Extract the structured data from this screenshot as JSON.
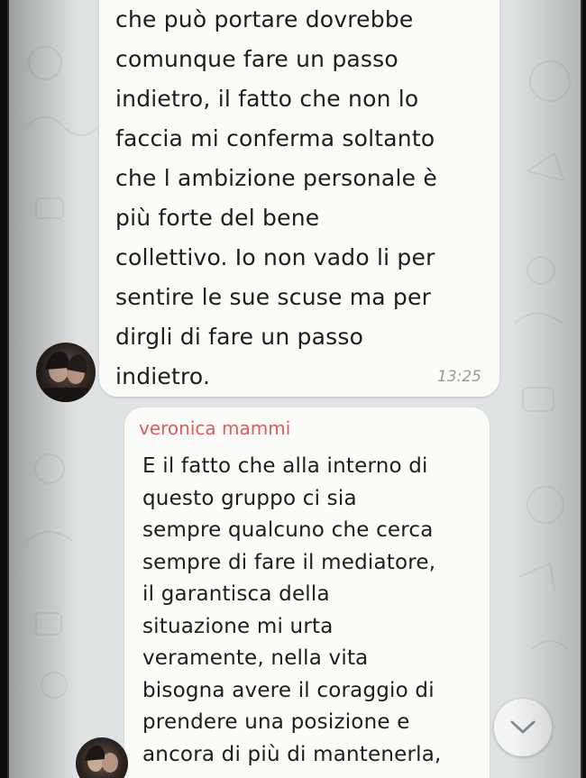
{
  "chat": {
    "messages": [
      {
        "text": "che può portare dovrebbe\ncomunque fare un passo\nindietro, il fatto che non lo\nfaccia mi conferma soltanto\nche l ambizione personale è\npiù forte del bene\ncollettivo. Io non vado li per\nsentire le sue scuse ma per\ndirgli di fare un passo\nindietro.",
        "time": "13:25"
      },
      {
        "sender": "veronica mammi",
        "sender_color": "#e0595b",
        "text": "E il fatto che alla interno di\nquesto gruppo ci sia\nsempre qualcuno che cerca\nsempre di fare il mediatore,\nil garantisca della\nsituazione mi urta\nveramente, nella vita\nbisogna avere il coraggio di\nprendere una posizione e\nancora di più di mantenerla,"
      }
    ]
  },
  "icons": {
    "scroll_down": "chevron-down-icon",
    "avatar": "user-avatar"
  },
  "colors": {
    "bubble_bg": "#fbfbf8",
    "wallpaper": "#dfe3e3",
    "sender_name": "#e0595b",
    "timestamp": "#9a9a9a"
  }
}
